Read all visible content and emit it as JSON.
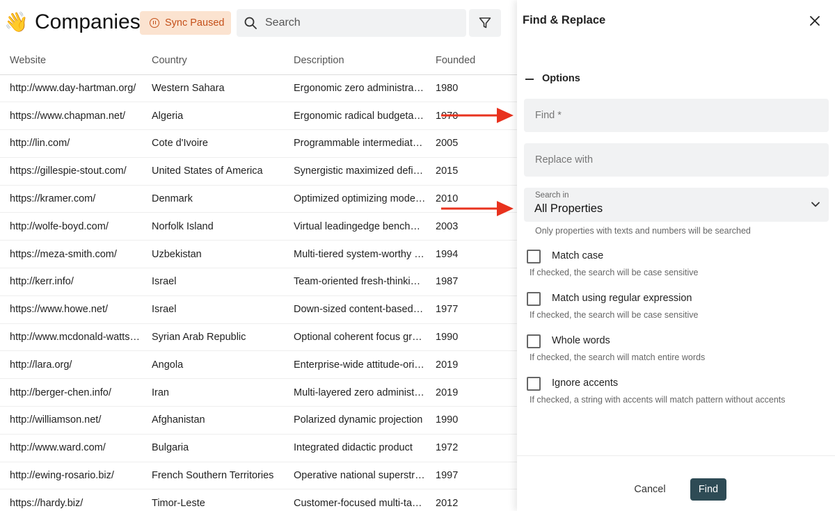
{
  "header": {
    "title": "Companies",
    "sync_label": "Sync Paused",
    "search_placeholder": "Search"
  },
  "table": {
    "columns": [
      "Website",
      "Country",
      "Description",
      "Founded"
    ],
    "rows": [
      [
        "http://www.day-hartman.org/",
        "Western Sahara",
        "Ergonomic zero administrat…",
        "1980"
      ],
      [
        "https://www.chapman.net/",
        "Algeria",
        "Ergonomic radical budgetar…",
        "1970"
      ],
      [
        "http://lin.com/",
        "Cote d'Ivoire",
        "Programmable intermediate…",
        "2005"
      ],
      [
        "https://gillespie-stout.com/",
        "United States of America",
        "Synergistic maximized defin…",
        "2015"
      ],
      [
        "https://kramer.com/",
        "Denmark",
        "Optimized optimizing mode…",
        "2010"
      ],
      [
        "http://wolfe-boyd.com/",
        "Norfolk Island",
        "Virtual leadingedge benchm…",
        "2003"
      ],
      [
        "https://meza-smith.com/",
        "Uzbekistan",
        "Multi-tiered system-worthy …",
        "1994"
      ],
      [
        "http://kerr.info/",
        "Israel",
        "Team-oriented fresh-thinkin…",
        "1987"
      ],
      [
        "https://www.howe.net/",
        "Israel",
        "Down-sized content-based i…",
        "1977"
      ],
      [
        "http://www.mcdonald-watts…",
        "Syrian Arab Republic",
        "Optional coherent focus gro…",
        "1990"
      ],
      [
        "http://lara.org/",
        "Angola",
        "Enterprise-wide attitude-ori…",
        "2019"
      ],
      [
        "http://berger-chen.info/",
        "Iran",
        "Multi-layered zero administr…",
        "2019"
      ],
      [
        "http://williamson.net/",
        "Afghanistan",
        "Polarized dynamic projection",
        "1990"
      ],
      [
        "http://www.ward.com/",
        "Bulgaria",
        "Integrated didactic product",
        "1972"
      ],
      [
        "http://ewing-rosario.biz/",
        "French Southern Territories",
        "Operative national superstr…",
        "1997"
      ],
      [
        "https://hardy.biz/",
        "Timor-Leste",
        "Customer-focused multi-tas…",
        "2012"
      ]
    ]
  },
  "panel": {
    "title": "Find & Replace",
    "options_label": "Options",
    "find_placeholder": "Find *",
    "replace_placeholder": "Replace with",
    "search_in_label": "Search in",
    "search_in_value": "All Properties",
    "search_in_hint": "Only properties with texts and numbers will be searched",
    "checkboxes": [
      {
        "label": "Match case",
        "hint": "If checked, the search will be case sensitive",
        "checked": false
      },
      {
        "label": "Match using regular expression",
        "hint": "If checked, the search will be case sensitive",
        "checked": false
      },
      {
        "label": "Whole words",
        "hint": "If checked, the search will match entire words",
        "checked": false
      },
      {
        "label": "Ignore accents",
        "hint": "If checked, a string with accents will match pattern without accents",
        "checked": false
      }
    ],
    "cancel_label": "Cancel",
    "find_label": "Find"
  },
  "colors": {
    "sync_bg": "#fbe3d0",
    "sync_fg": "#c4501a",
    "find_button": "#2e4b55",
    "annotation_arrow": "#e8321e"
  }
}
